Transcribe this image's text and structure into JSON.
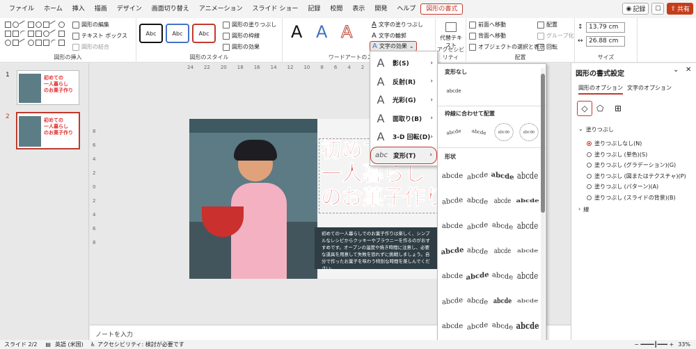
{
  "menu": {
    "tabs": [
      "ファイル",
      "ホーム",
      "挿入",
      "描画",
      "デザイン",
      "画面切り替え",
      "アニメーション",
      "スライド ショー",
      "記録",
      "校閲",
      "表示",
      "開発",
      "ヘルプ",
      "図形の書式"
    ],
    "active": "図形の書式"
  },
  "topright": {
    "record": "記録",
    "share": "共有"
  },
  "ribbon": {
    "insert_shapes": {
      "edit_shape": "図形の編集",
      "text_box": "テキスト ボックス",
      "merge_shapes": "図形の結合",
      "label": "図形の挿入"
    },
    "shape_styles": {
      "style_label": "Abc",
      "fill": "図形の塗りつぶし",
      "outline": "図形の枠線",
      "effects": "図形の効果",
      "label": "図形のスタイル"
    },
    "wordart": {
      "sample": "A",
      "text_fill": "文字の塗りつぶし",
      "text_outline": "文字の輪郭",
      "text_effects": "文字の効果",
      "label": "ワードアートのスタイル"
    },
    "accessibility": {
      "alt_text": "代替テキスト",
      "label": "アクセシビリティ"
    },
    "arrange": {
      "bring_forward": "前面へ移動",
      "send_backward": "背面へ移動",
      "selection_pane": "オブジェクトの選択と表示",
      "align": "配置",
      "group": "グループ化",
      "rotate": "回転",
      "label": "配置"
    },
    "size": {
      "height": "13.79 cm",
      "width": "26.88 cm",
      "label": "サイズ"
    }
  },
  "thumbnails": [
    {
      "num": "1",
      "text": "初めての\n一人暮らし\nのお菓子作り"
    },
    {
      "num": "2",
      "text": "初めての\n一人暮らし\nのお菓子作り"
    }
  ],
  "ruler": {
    "top": [
      "24",
      "22",
      "20",
      "18",
      "16",
      "14",
      "12",
      "10",
      "8",
      "6",
      "4",
      "2"
    ],
    "left": [
      "8",
      "6",
      "4",
      "2",
      "0",
      "2",
      "4",
      "6",
      "8"
    ]
  },
  "slide": {
    "title_lines": [
      "初めての",
      "一人暮らし",
      "のお菓子作り"
    ],
    "body": "初めての一人暮らしでのお菓子作りは楽しく、シンプルなレシピからクッキーやブラウニーを作るのがおすすめです。オーブンの温度や焼き時間に注意し、必要な道具を用意して失敗を恐れずに挑戦しましょう。自分で作ったお菓子を味わう特別な時間を楽しんでください。"
  },
  "text_effects_menu": [
    {
      "label": "影(S)",
      "glyph": "A"
    },
    {
      "label": "反射(R)",
      "glyph": "A"
    },
    {
      "label": "光彩(G)",
      "glyph": "A"
    },
    {
      "label": "面取り(B)",
      "glyph": "A"
    },
    {
      "label": "3-D 回転(D)",
      "glyph": "A"
    },
    {
      "label": "変形(T)",
      "glyph": "abc"
    }
  ],
  "transform_gallery": {
    "no_transform": "変形なし",
    "sample_plain": "abcde",
    "follow_path": "枠線に合わせて配置",
    "warp": "形状",
    "sample": "abcde"
  },
  "format_pane": {
    "title": "図形の書式設定",
    "tabs": [
      "図形のオプション",
      "文字のオプション"
    ],
    "fill_section": "塗りつぶし",
    "fill_options": [
      "塗りつぶしなし(N)",
      "塗りつぶし (単色)(S)",
      "塗りつぶし (グラデーション)(G)",
      "塗りつぶし (図またはテクスチャ)(P)",
      "塗りつぶし (パターン)(A)",
      "塗りつぶし (スライドの背景)(B)"
    ],
    "fill_selected": 0,
    "line_section": "線"
  },
  "notes": {
    "placeholder": "ノートを入力"
  },
  "status": {
    "slide": "スライド 2/2",
    "lang": "英語 (米国)",
    "accessibility": "アクセシビリティ: 検討が必要です",
    "zoom": "33%"
  },
  "colors": {
    "accent": "#c0392b",
    "title_red": "#e03a3a"
  }
}
